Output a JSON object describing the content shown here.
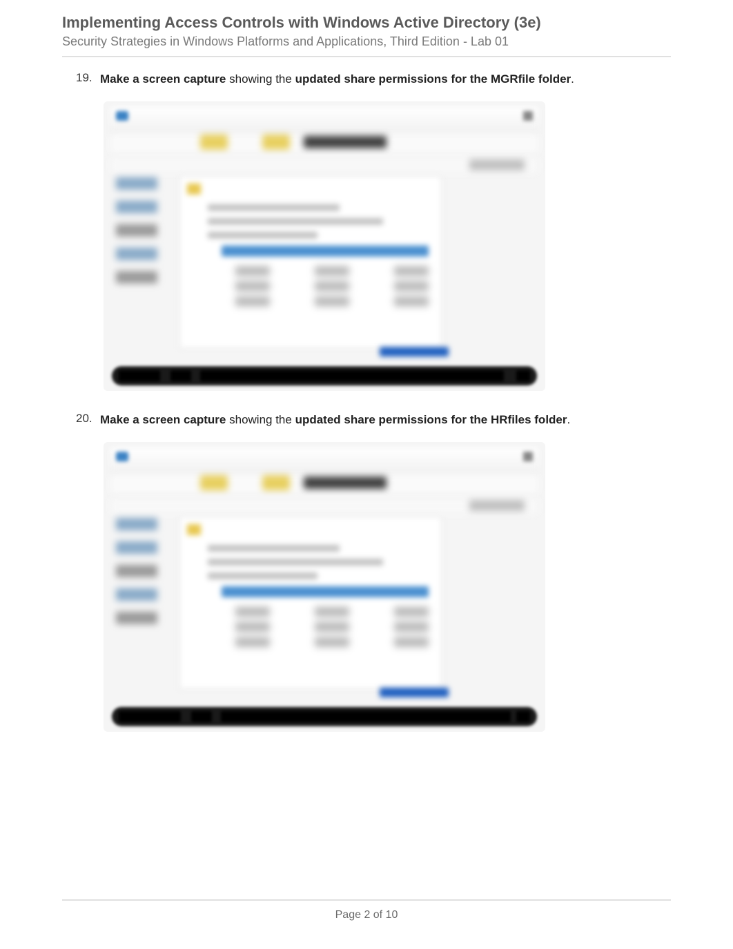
{
  "header": {
    "title": "Implementing Access Controls with Windows Active Directory (3e)",
    "subtitle": "Security Strategies in Windows Platforms and Applications, Third Edition - Lab 01"
  },
  "items": [
    {
      "num": "19.",
      "action": "Make a screen capture",
      "mid": " showing the ",
      "target": "updated share permissions for the MGRfile folder",
      "end": "."
    },
    {
      "num": "20.",
      "action": "Make a screen capture",
      "mid": " showing the ",
      "target": "updated share permissions for the HRfiles folder",
      "end": "."
    }
  ],
  "footer": {
    "page": "Page 2 of 10"
  }
}
